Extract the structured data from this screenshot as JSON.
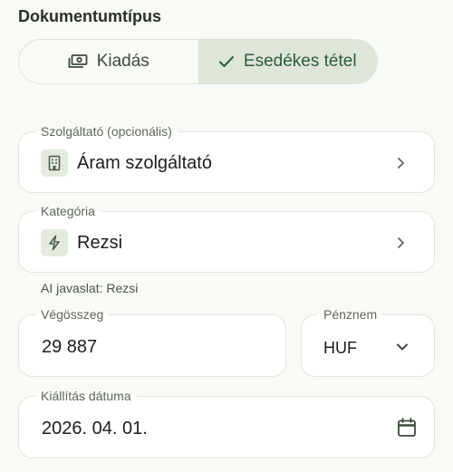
{
  "document_type": {
    "title": "Dokumentumtípus",
    "options": [
      {
        "label": "Kiadás",
        "icon": "cash-icon",
        "selected": false
      },
      {
        "label": "Esedékes tétel",
        "icon": "check-icon",
        "selected": true
      }
    ]
  },
  "provider": {
    "label": "Szolgáltató (opcionális)",
    "value": "Áram szolgáltató",
    "icon": "building-icon"
  },
  "category": {
    "label": "Kategória",
    "value": "Rezsi",
    "icon": "lightning-icon",
    "ai_hint": "AI javaslat: Rezsi"
  },
  "amount": {
    "label": "Végösszeg",
    "value": "29 887"
  },
  "currency": {
    "label": "Pénznem",
    "value": "HUF"
  },
  "issue_date": {
    "label": "Kiállítás dátuma",
    "value": "2026. 04. 01.",
    "icon": "calendar-icon"
  },
  "colors": {
    "accent": "#2e5c35",
    "selected_bg": "#dde6d9",
    "icon_bg": "#e3ebe0"
  }
}
